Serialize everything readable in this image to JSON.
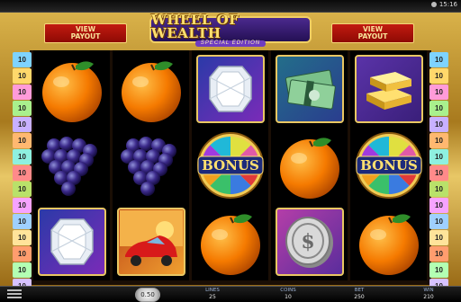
{
  "clock": "15:16",
  "header": {
    "view_payout_left": [
      "VIEW",
      "PAYOUT"
    ],
    "view_payout_right": [
      "VIEW",
      "PAYOUT"
    ],
    "logo_title": "WHEEL OF WEALTH",
    "logo_subtitle": "SPECIAL EDITION"
  },
  "paylines": {
    "left": [
      "10",
      "10",
      "10",
      "10",
      "10",
      "10",
      "10",
      "10",
      "10",
      "10",
      "10",
      "10",
      "10",
      "10",
      "10"
    ],
    "right": [
      "10",
      "10",
      "10",
      "10",
      "10",
      "10",
      "10",
      "10",
      "10",
      "10",
      "10",
      "10",
      "10",
      "10",
      "10"
    ],
    "colors": [
      "#7ed3ff",
      "#ffd86b",
      "#ff9bd9",
      "#a9f08d",
      "#c8b0ff",
      "#ffb870",
      "#8ef0e0",
      "#ff8a8a",
      "#b9e16a",
      "#f6a3ff",
      "#9fd0ff",
      "#ffe49a",
      "#ff9d6e",
      "#b3ffb3",
      "#d7c2ff"
    ]
  },
  "reels": [
    [
      "orange",
      "grapes",
      "diamond"
    ],
    [
      "orange",
      "grapes",
      "sports-car"
    ],
    [
      "diamond",
      "bonus-wheel",
      "orange"
    ],
    [
      "cash-bundle",
      "orange",
      "silver-coin"
    ],
    [
      "gold-bars",
      "bonus-wheel",
      "orange"
    ]
  ],
  "symbol_labels": {
    "bonus": "BONUS"
  },
  "bottom": {
    "coin_value": "0.50",
    "lines_label": "LINES",
    "lines_value": "25",
    "coins_label": "COINS",
    "coins_value": "10",
    "bet_label": "BET",
    "bet_value": "250",
    "win_label": "WIN",
    "win_value": "210"
  }
}
